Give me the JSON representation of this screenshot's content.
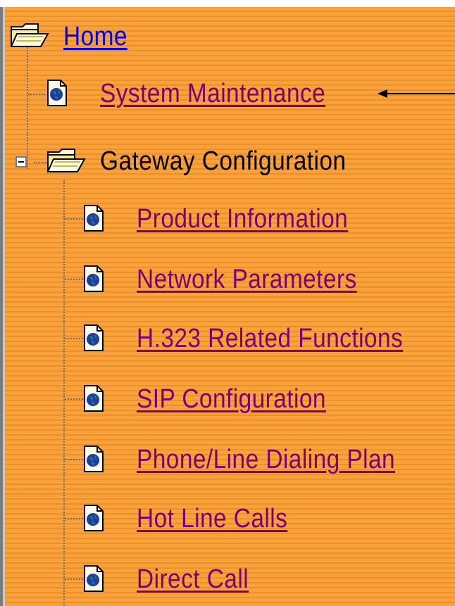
{
  "tree": {
    "home": {
      "label": "Home",
      "icon": "open-folder-icon"
    },
    "system_maintenance": {
      "label": "System Maintenance",
      "icon": "web-page-icon"
    },
    "gateway_configuration": {
      "label": "Gateway Configuration",
      "icon": "open-folder-icon",
      "toggle_icon": "collapse-minus-icon",
      "children": [
        {
          "label": "Product Information",
          "icon": "web-page-icon"
        },
        {
          "label": "Network Parameters",
          "icon": "web-page-icon"
        },
        {
          "label": "H.323 Related Functions",
          "icon": "web-page-icon"
        },
        {
          "label": "SIP Configuration",
          "icon": "web-page-icon"
        },
        {
          "label": "Phone/Line Dialing Plan",
          "icon": "web-page-icon"
        },
        {
          "label": "Hot Line Calls",
          "icon": "web-page-icon"
        },
        {
          "label": "Direct Call",
          "icon": "web-page-icon"
        }
      ]
    }
  },
  "annotation": {
    "icon": "left-arrow-icon"
  },
  "colors": {
    "background": "#f7a23a",
    "stripe": "#f08f2a",
    "visited_link": "#7a007a",
    "home_link": "#0000ee",
    "text": "#000000"
  }
}
